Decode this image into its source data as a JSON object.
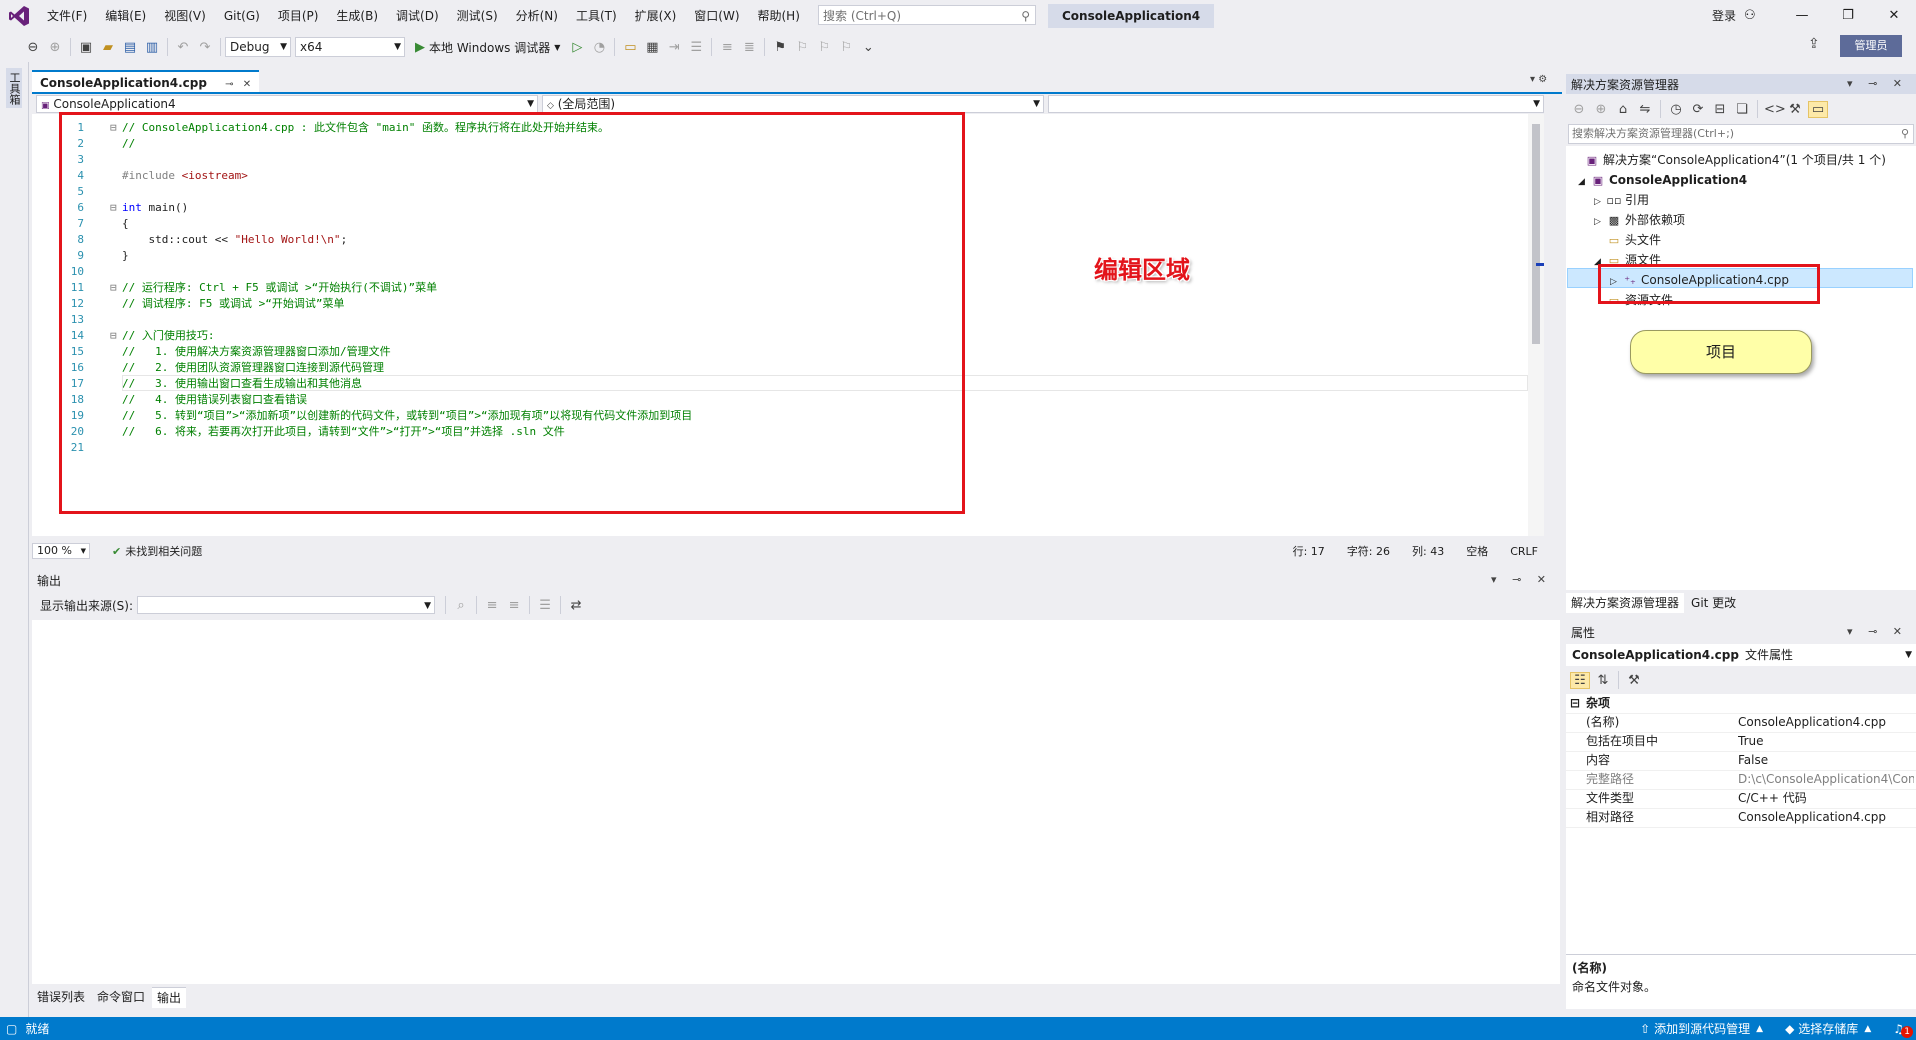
{
  "titlebar": {
    "menu": [
      "文件(F)",
      "编辑(E)",
      "视图(V)",
      "Git(G)",
      "项目(P)",
      "生成(B)",
      "调试(D)",
      "测试(S)",
      "分析(N)",
      "工具(T)",
      "扩展(X)",
      "窗口(W)",
      "帮助(H)"
    ],
    "search_placeholder": "搜索 (Ctrl+Q)",
    "solution_name": "ConsoleApplication4",
    "login": "登录"
  },
  "toolbar": {
    "config": "Debug",
    "platform": "x64",
    "run_label": "本地 Windows 调试器",
    "admin": "管理员"
  },
  "left_strip": {
    "toolbox": "工具箱"
  },
  "editor": {
    "tab_title": "ConsoleApplication4.cpp",
    "nav_project": "ConsoleApplication4",
    "nav_scope": "(全局范围)",
    "nav_member": "",
    "lines": [
      {
        "n": "1",
        "fold": "⊟",
        "parts": [
          {
            "t": "// ConsoleApplication4.cpp : 此文件包含 \"main\" 函数。程序执行将在此处开始并结束。",
            "c": "c-com"
          }
        ]
      },
      {
        "n": "2",
        "fold": "",
        "parts": [
          {
            "t": "//",
            "c": "c-com"
          }
        ]
      },
      {
        "n": "3",
        "fold": "",
        "parts": []
      },
      {
        "n": "4",
        "fold": "",
        "parts": [
          {
            "t": "#include ",
            "c": "c-pp"
          },
          {
            "t": "<iostream>",
            "c": "c-str"
          }
        ]
      },
      {
        "n": "5",
        "fold": "",
        "parts": []
      },
      {
        "n": "6",
        "fold": "⊟",
        "parts": [
          {
            "t": "int",
            "c": "c-kw"
          },
          {
            "t": " main()",
            "c": "c-pl"
          }
        ]
      },
      {
        "n": "7",
        "fold": "",
        "parts": [
          {
            "t": "{",
            "c": "c-pl"
          }
        ]
      },
      {
        "n": "8",
        "fold": "",
        "parts": [
          {
            "t": "    std::cout << ",
            "c": "c-pl"
          },
          {
            "t": "\"Hello World!\\n\"",
            "c": "c-str"
          },
          {
            "t": ";",
            "c": "c-pl"
          }
        ]
      },
      {
        "n": "9",
        "fold": "",
        "parts": [
          {
            "t": "}",
            "c": "c-pl"
          }
        ]
      },
      {
        "n": "10",
        "fold": "",
        "parts": []
      },
      {
        "n": "11",
        "fold": "⊟",
        "parts": [
          {
            "t": "// 运行程序: Ctrl + F5 或调试 >“开始执行(不调试)”菜单",
            "c": "c-com"
          }
        ]
      },
      {
        "n": "12",
        "fold": "",
        "parts": [
          {
            "t": "// 调试程序: F5 或调试 >“开始调试”菜单",
            "c": "c-com"
          }
        ]
      },
      {
        "n": "13",
        "fold": "",
        "parts": []
      },
      {
        "n": "14",
        "fold": "⊟",
        "parts": [
          {
            "t": "// 入门使用技巧:",
            "c": "c-com"
          }
        ]
      },
      {
        "n": "15",
        "fold": "",
        "parts": [
          {
            "t": "//   1. 使用解决方案资源管理器窗口添加/管理文件",
            "c": "c-com"
          }
        ]
      },
      {
        "n": "16",
        "fold": "",
        "parts": [
          {
            "t": "//   2. 使用团队资源管理器窗口连接到源代码管理",
            "c": "c-com"
          }
        ]
      },
      {
        "n": "17",
        "fold": "",
        "parts": [
          {
            "t": "//   3. 使用输出窗口查看生成输出和其他消息",
            "c": "c-com"
          }
        ]
      },
      {
        "n": "18",
        "fold": "",
        "parts": [
          {
            "t": "//   4. 使用错误列表窗口查看错误",
            "c": "c-com"
          }
        ]
      },
      {
        "n": "19",
        "fold": "",
        "parts": [
          {
            "t": "//   5. 转到“项目”>“添加新项”以创建新的代码文件，或转到“项目”>“添加现有项”以将现有代码文件添加到项目",
            "c": "c-com"
          }
        ]
      },
      {
        "n": "20",
        "fold": "",
        "parts": [
          {
            "t": "//   6. 将来，若要再次打开此项目，请转到“文件”>“打开”>“项目”并选择 .sln 文件",
            "c": "c-com"
          }
        ]
      },
      {
        "n": "21",
        "fold": "",
        "parts": []
      }
    ],
    "annotation_label": "编辑区域",
    "status": {
      "zoom": "100 %",
      "issues": "未找到相关问题",
      "line": "行: 17",
      "char": "字符: 26",
      "col": "列: 43",
      "whitespace": "空格",
      "eol": "CRLF"
    }
  },
  "output": {
    "title": "输出",
    "source_label": "显示输出来源(S):",
    "source_value": ""
  },
  "bottom_tabs": [
    "错误列表",
    "命令窗口",
    "输出"
  ],
  "solution_explorer": {
    "title": "解决方案资源管理器",
    "search_placeholder": "搜索解决方案资源管理器(Ctrl+;)",
    "solution": "解决方案“ConsoleApplication4”(1 个项目/共 1 个)",
    "project": "ConsoleApplication4",
    "nodes": [
      "引用",
      "外部依赖项",
      "头文件",
      "源文件",
      "ConsoleApplication4.cpp",
      "资源文件"
    ],
    "annotation_label": "项目",
    "tabs": [
      "解决方案资源管理器",
      "Git 更改"
    ]
  },
  "properties": {
    "title": "属性",
    "object_name": "ConsoleApplication4.cpp",
    "object_type": "文件属性",
    "category": "杂项",
    "rows": [
      {
        "name": "(名称)",
        "value": "ConsoleApplication4.cpp"
      },
      {
        "name": "包括在项目中",
        "value": "True"
      },
      {
        "name": "内容",
        "value": "False"
      },
      {
        "name": "完整路径",
        "value": "D:\\c\\ConsoleApplication4\\Con"
      },
      {
        "name": "文件类型",
        "value": "C/C++ 代码"
      },
      {
        "name": "相对路径",
        "value": "ConsoleApplication4.cpp"
      }
    ],
    "desc_title": "(名称)",
    "desc_text": "命名文件对象。"
  },
  "statusbar": {
    "ready": "就绪",
    "add_source": "添加到源代码管理",
    "select_repo": "选择存储库",
    "notif_count": "1"
  },
  "colors": {
    "accent": "#007acc",
    "annotation": "#e3141b",
    "bubble": "#ffffa8"
  }
}
